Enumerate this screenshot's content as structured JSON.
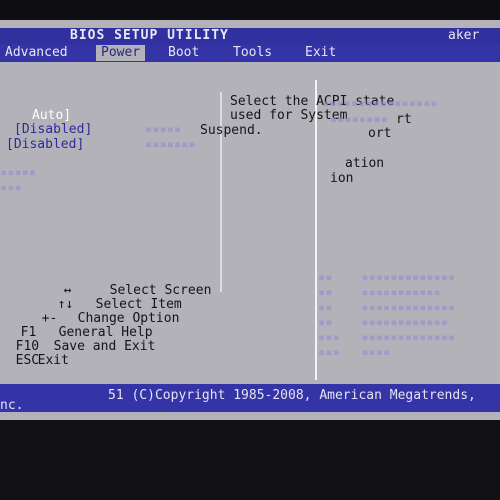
{
  "header": {
    "title": "BIOS SETUP UTILITY",
    "maker": "aker"
  },
  "menu": [
    {
      "label": "Advanced",
      "active": false
    },
    {
      "label": "Power",
      "active": true
    },
    {
      "label": "Boot",
      "active": false
    },
    {
      "label": "Tools",
      "active": false
    },
    {
      "label": "Exit",
      "active": false
    }
  ],
  "options": [
    {
      "value": "Auto]",
      "selected": true
    },
    {
      "value": "[Disabled]",
      "selected": false
    },
    {
      "value": "[Disabled]",
      "selected": false
    }
  ],
  "help": {
    "lines": [
      "Select the ACPI state",
      "used for System",
      "Suspend."
    ],
    "fragments": [
      "rt",
      "ort",
      "ation",
      "ion"
    ]
  },
  "keys": [
    {
      "key": "↔",
      "action": "Select Screen"
    },
    {
      "key": "↑↓",
      "action": "Select Item"
    },
    {
      "key": "+-",
      "action": "Change Option"
    },
    {
      "key": "F1",
      "action": "General Help"
    },
    {
      "key": "F10",
      "action": "Save and Exit"
    },
    {
      "key": "ESC",
      "action": "Exit"
    }
  ],
  "footer": {
    "copyright": "51 (C)Copyright 1985-2008, American Megatrends,",
    "inc": "nc."
  },
  "colors": {
    "bar": "#3434a6",
    "panel": "#b3b2b8",
    "option_text": "#2c2c9c"
  }
}
